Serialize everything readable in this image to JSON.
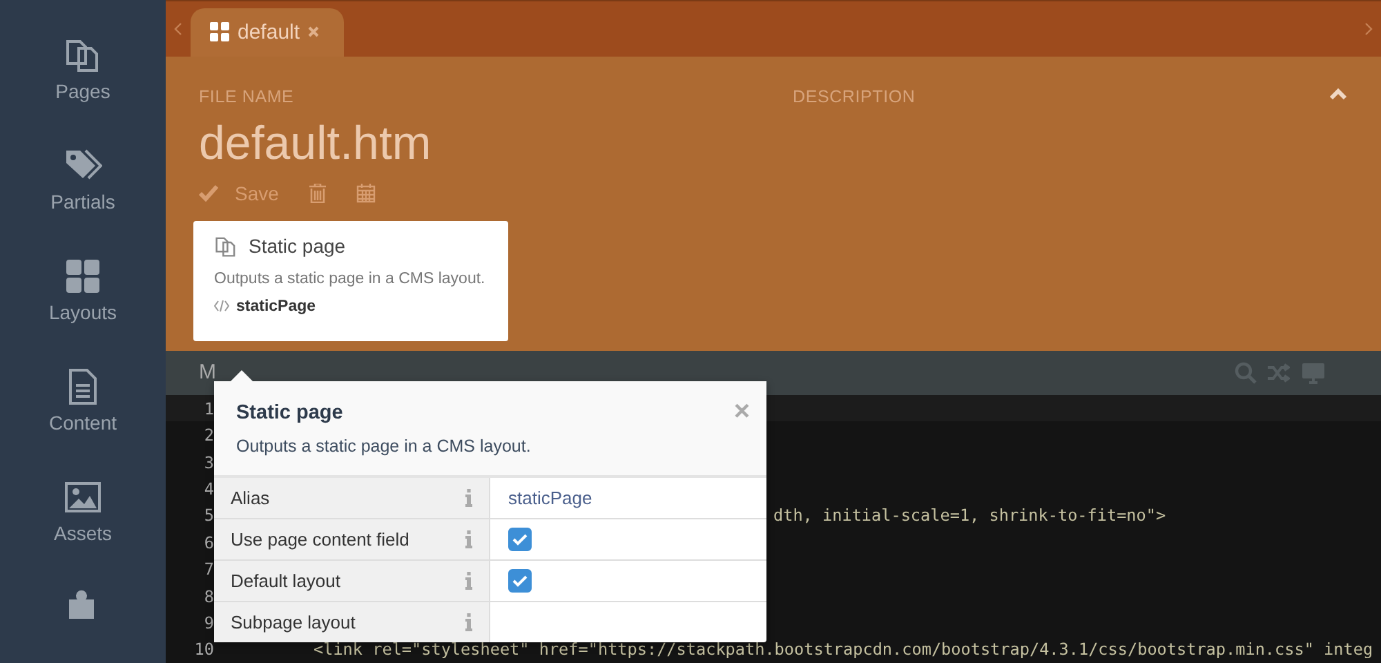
{
  "sidebar": {
    "items": [
      {
        "label": "Pages",
        "selected": false
      },
      {
        "label": "Partials",
        "selected": false
      },
      {
        "label": "Layouts",
        "selected": false
      },
      {
        "label": "Content",
        "selected": false
      },
      {
        "label": "Assets",
        "selected": false
      },
      {
        "selected": false
      }
    ]
  },
  "tabs": [
    {
      "label": "default",
      "selected": true
    }
  ],
  "form": {
    "file_name_label": "FILE NAME",
    "file_name": "default.htm",
    "description_label": "DESCRIPTION",
    "save_label": "Save"
  },
  "component_card": {
    "title": "Static page",
    "description": "Outputs a static page in a CMS layout.",
    "alias": "staticPage"
  },
  "editor_toolbar": {
    "label": "M"
  },
  "code": {
    "lines": [
      {
        "number": "1"
      },
      {
        "number": "2"
      },
      {
        "number": "3"
      },
      {
        "number": "4"
      },
      {
        "number": "5",
        "text": "dth, initial-scale=1, shrink-to-fit=no\">",
        "kind": "behind"
      },
      {
        "number": "6"
      },
      {
        "number": "7"
      },
      {
        "number": "8"
      },
      {
        "number": "9"
      },
      {
        "number": "10",
        "text": "<link rel=\"stylesheet\" href=\"https://stackpath.bootstrapcdn.com/bootstrap/4.3.1/css/bootstrap.min.css\" integ",
        "kind": "full"
      }
    ]
  },
  "popup": {
    "title": "Static page",
    "description": "Outputs a static page in a CMS layout.",
    "close": "×",
    "properties": [
      {
        "label": "Alias",
        "kind": "text",
        "value": "staticPage"
      },
      {
        "label": "Use page content field",
        "kind": "checkbox",
        "checked": true
      },
      {
        "label": "Default layout",
        "kind": "checkbox",
        "checked": true
      },
      {
        "label": "Subpage layout",
        "kind": "text"
      }
    ]
  }
}
